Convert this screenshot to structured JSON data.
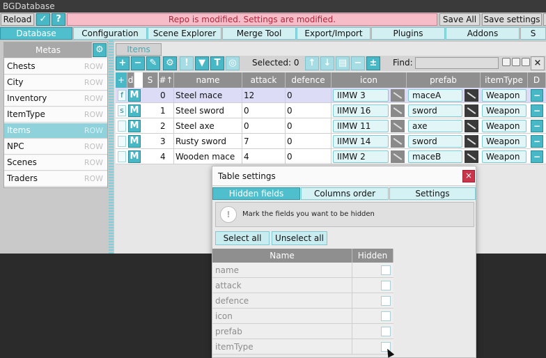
{
  "app": {
    "title": "BGDatabase"
  },
  "topbar": {
    "reload": "Reload",
    "status": "Repo is modified. Settings are modified.",
    "save_all": "Save All",
    "save_settings": "Save settings",
    "more": "S"
  },
  "tabs": [
    "Database",
    "Configuration",
    "Scene Explorer",
    "Merge Tool",
    "Export/Import",
    "Plugins",
    "Addons",
    "S"
  ],
  "metas": {
    "header": "Metas",
    "items": [
      {
        "name": "Chests",
        "kind": "ROW"
      },
      {
        "name": "City",
        "kind": "ROW"
      },
      {
        "name": "Inventory",
        "kind": "ROW"
      },
      {
        "name": "ItemType",
        "kind": "ROW"
      },
      {
        "name": "Items",
        "kind": "ROW"
      },
      {
        "name": "NPC",
        "kind": "ROW"
      },
      {
        "name": "Scenes",
        "kind": "ROW"
      },
      {
        "name": "Traders",
        "kind": "ROW"
      }
    ],
    "selected_index": 4
  },
  "items_tab": "Items",
  "toolbar": {
    "selected_label": "Selected:",
    "selected_count": "0",
    "find_label": "Find:",
    "find_value": ""
  },
  "grid": {
    "headers": {
      "id": "d",
      "s": "S",
      "index": "#↑",
      "name": "name",
      "attack": "attack",
      "defence": "defence",
      "icon": "icon",
      "prefab": "prefab",
      "itemType": "itemType",
      "d": "D"
    },
    "rows": [
      {
        "flag": "f",
        "m": "M",
        "index": "0",
        "name": "Steel mace",
        "attack": "12",
        "defence": "0",
        "icon": "IIMW 3",
        "prefab": "maceA",
        "itemType": "Weapon"
      },
      {
        "flag": "s",
        "m": "M",
        "index": "1",
        "name": "Steel sword",
        "attack": "0",
        "defence": "0",
        "icon": "IIMW 16",
        "prefab": "sword",
        "itemType": "Weapon"
      },
      {
        "flag": "",
        "m": "M",
        "index": "2",
        "name": "Steel axe",
        "attack": "0",
        "defence": "0",
        "icon": "IIMW 11",
        "prefab": "axe",
        "itemType": "Weapon"
      },
      {
        "flag": "",
        "m": "M",
        "index": "3",
        "name": "Rusty sword",
        "attack": "7",
        "defence": "0",
        "icon": "IIMW 14",
        "prefab": "sword",
        "itemType": "Weapon"
      },
      {
        "flag": "",
        "m": "M",
        "index": "4",
        "name": "Wooden mace",
        "attack": "4",
        "defence": "0",
        "icon": "IIMW 2",
        "prefab": "maceB",
        "itemType": "Weapon"
      }
    ]
  },
  "dialog": {
    "title": "Table settings",
    "close": "×",
    "tabs": [
      "Hidden fields",
      "Columns order",
      "Settings"
    ],
    "info_text": "Mark the fields you want to be hidden",
    "select_all": "Select all",
    "unselect_all": "Unselect all",
    "col_name": "Name",
    "col_hidden": "Hidden",
    "fields": [
      "name",
      "attack",
      "defence",
      "icon",
      "prefab",
      "itemType"
    ]
  },
  "colors": {
    "accent": "#49b8c6",
    "status_bg": "#f6bcc8",
    "status_text": "#b0273c",
    "close": "#c9354a"
  }
}
